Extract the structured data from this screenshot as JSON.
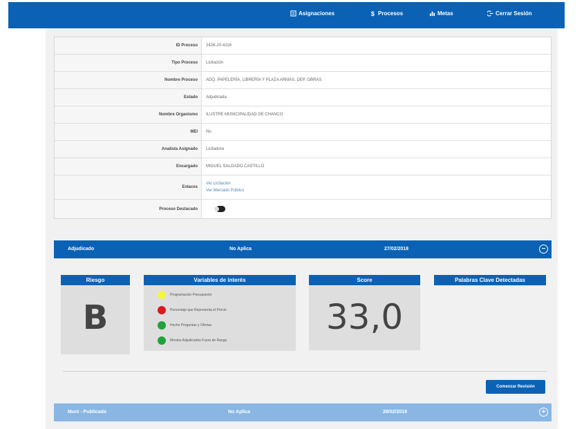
{
  "nav": {
    "assignments": "Asignaciones",
    "processes": "Procesos",
    "metrics": "Metas",
    "logout": "Cerrar Sesión"
  },
  "info": {
    "rows": [
      {
        "label": "ID Proceso",
        "value": "2426-20-4116"
      },
      {
        "label": "Tipo Proceso",
        "value": "Licitación"
      },
      {
        "label": "Nombre Proceso",
        "value": "ADQ. PAPELERÍA, LIBRERÍA Y PLAZA ARMAS, DEP. OBRAS"
      },
      {
        "label": "Estado",
        "value": "Adjudicada"
      },
      {
        "label": "Nombre Organismo",
        "value": "ILUSTRE MUNICIPALIDAD DE CHANCO"
      },
      {
        "label": "MEI",
        "value": "No"
      },
      {
        "label": "Analista Asignado",
        "value": "Licitadora"
      },
      {
        "label": "Encargado",
        "value": "MIGUEL SALGADO CASTILLO"
      }
    ],
    "links_label": "Enlaces",
    "link1": "Ver Licitación",
    "link2": "Ver Mercado Público",
    "featured_label": "Proceso Destacado"
  },
  "section1": {
    "status": "Adjudicado",
    "applies": "No Aplica",
    "date": "27/02/2018",
    "toggle": "−"
  },
  "panels": {
    "risk_title": "Riesgo",
    "risk_value": "B",
    "vars_title": "Variables de interés",
    "score_title": "Score",
    "score_value": "33,0",
    "keywords_title": "Palabras Clave Detectadas",
    "variables": [
      {
        "label": "Programación Presupuesto",
        "color": "#f5f53c"
      },
      {
        "label": "Porcentaje que Representa el Precio",
        "color": "#d81b1b"
      },
      {
        "label": "Hecho Preguntas y Ofertas",
        "color": "#1fa33a"
      },
      {
        "label": "Montos Adjudicados Fuera de Rango",
        "color": "#1fa33a"
      }
    ]
  },
  "button": {
    "label": "Comenzar Revisión"
  },
  "section2": {
    "status": "Muni - Publicado",
    "applies": "No Aplica",
    "date": "28/02/2018",
    "toggle": "+"
  }
}
